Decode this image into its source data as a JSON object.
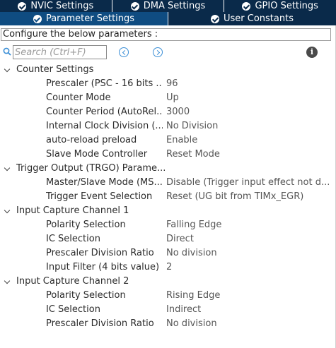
{
  "tabs_top": [
    {
      "label": "NVIC Settings"
    },
    {
      "label": "DMA Settings"
    },
    {
      "label": "GPIO Settings"
    }
  ],
  "tabs_bottom": [
    {
      "label": "Parameter Settings",
      "active": true
    },
    {
      "label": "User Constants",
      "active": false
    }
  ],
  "config_text": "Configure the below parameters :",
  "search": {
    "placeholder": "Search (Ctrl+F)"
  },
  "info_glyph": "i",
  "groups": [
    {
      "label": "Counter Settings",
      "params": [
        {
          "name": "Prescaler (PSC - 16 bits ...",
          "value": "96"
        },
        {
          "name": "Counter Mode",
          "value": "Up"
        },
        {
          "name": "Counter Period (AutoRel...",
          "value": "3000"
        },
        {
          "name": "Internal Clock Division (...",
          "value": "No Division"
        },
        {
          "name": "auto-reload preload",
          "value": "Enable"
        },
        {
          "name": "Slave Mode Controller",
          "value": "Reset Mode"
        }
      ]
    },
    {
      "label": "Trigger Output (TRGO) Parame...",
      "params": [
        {
          "name": "Master/Slave Mode (MS...",
          "value": "Disable (Trigger input effect not d..."
        },
        {
          "name": "Trigger Event Selection",
          "value": "Reset (UG bit from TIMx_EGR)"
        }
      ]
    },
    {
      "label": "Input Capture Channel 1",
      "params": [
        {
          "name": "Polarity Selection",
          "value": "Falling Edge"
        },
        {
          "name": "IC Selection",
          "value": "Direct"
        },
        {
          "name": "Prescaler Division Ratio",
          "value": "No division"
        },
        {
          "name": "Input Filter (4 bits value)",
          "value": "2"
        }
      ]
    },
    {
      "label": "Input Capture Channel 2",
      "params": [
        {
          "name": "Polarity Selection",
          "value": "Rising Edge"
        },
        {
          "name": "IC Selection",
          "value": "Indirect"
        },
        {
          "name": "Prescaler Division Ratio",
          "value": "No division"
        }
      ]
    }
  ],
  "colors": {
    "tab_dark": "#0a2a4a",
    "tab_active": "#0f4c81",
    "accent": "#3c8fd6"
  }
}
